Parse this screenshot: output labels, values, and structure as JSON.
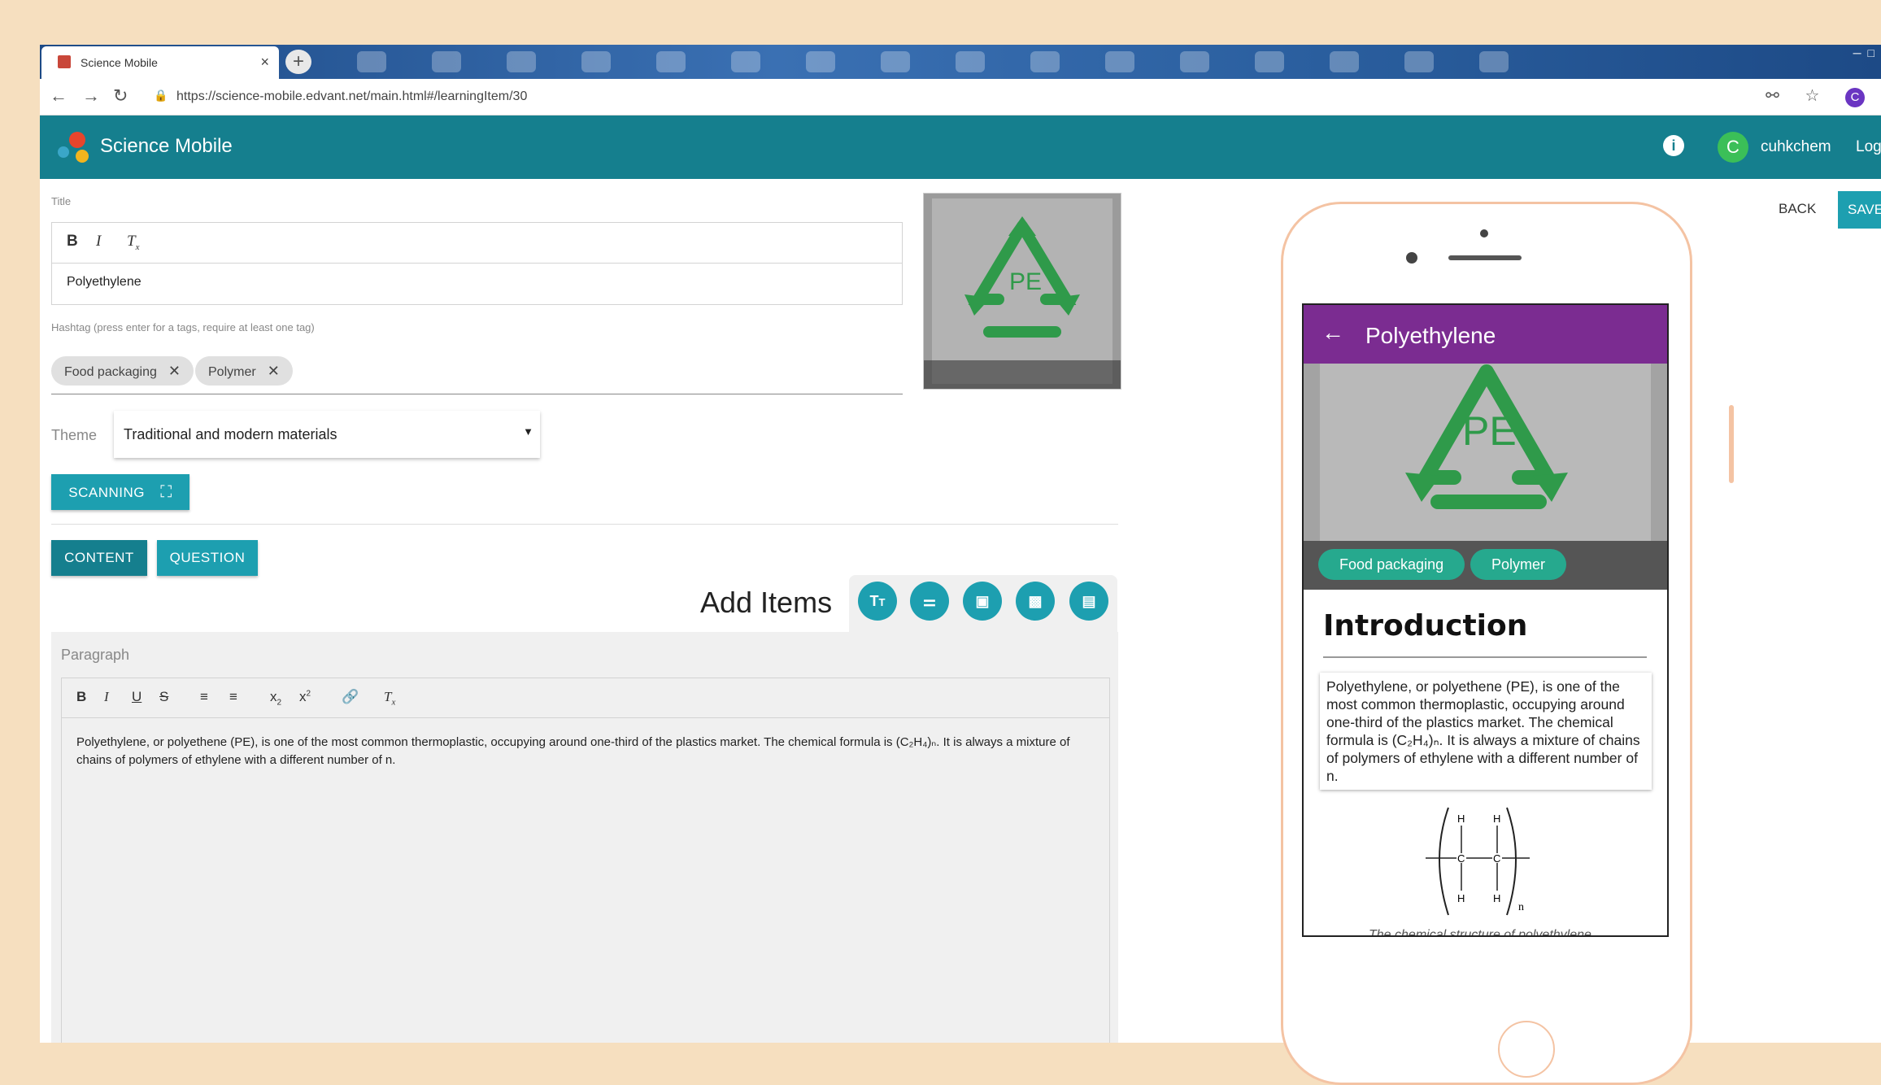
{
  "browser": {
    "tab_title": "Science Mobile",
    "tab_close": "×",
    "new_tab": "+",
    "url": "https://science-mobile.edvant.net/main.html#/learningItem/30",
    "profile_initial": "C"
  },
  "appbar": {
    "name": "Science Mobile",
    "info": "i",
    "avatar_initial": "C",
    "username": "cuhkchem",
    "logout_label": "Logout"
  },
  "editor": {
    "title_label": "Title",
    "title_value": "Polyethylene",
    "hashtag_label": "Hashtag (press enter for a tags, require at least one tag)",
    "tags": [
      "Food packaging",
      "Polymer"
    ],
    "theme_label": "Theme",
    "theme_value": "Traditional and modern materials",
    "scanning_label": "SCANNING",
    "content_tab": "CONTENT",
    "question_tab": "QUESTION",
    "add_items_label": "Add Items",
    "paragraph_label": "Paragraph",
    "paragraph_text": "Polyethylene, or polyethene (PE), is one of the most common thermoplastic, occupying around one-third of the plastics market. The chemical formula is (C₂H₄)ₙ. It is always a mixture of chains of polymers of ethylene with a different number of n."
  },
  "actions": {
    "back_label": "BACK",
    "save_label": "SAVE"
  },
  "preview": {
    "title": "Polyethylene",
    "image_label": "PE",
    "tags": [
      "Food packaging",
      "Polymer"
    ],
    "section_heading": "Introduction",
    "paragraph_text": "Polyethylene, or polyethene (PE), is one of the most common thermoplastic, occupying around one-third of the plastics market. The chemical formula is (C₂H₄)ₙ. It is always a mixture of chains of polymers of ethylene with a different number of n.",
    "structure_atom_h": "H",
    "structure_atom_c": "C",
    "structure_subscript": "n",
    "caption": "The chemical structure of polyethylene"
  },
  "colors": {
    "appbar": "#157f8e",
    "accent": "#1d9fb0",
    "preview_header": "#7b2c91",
    "preview_chip": "#26a98e",
    "page_background": "#f6dfbf"
  }
}
